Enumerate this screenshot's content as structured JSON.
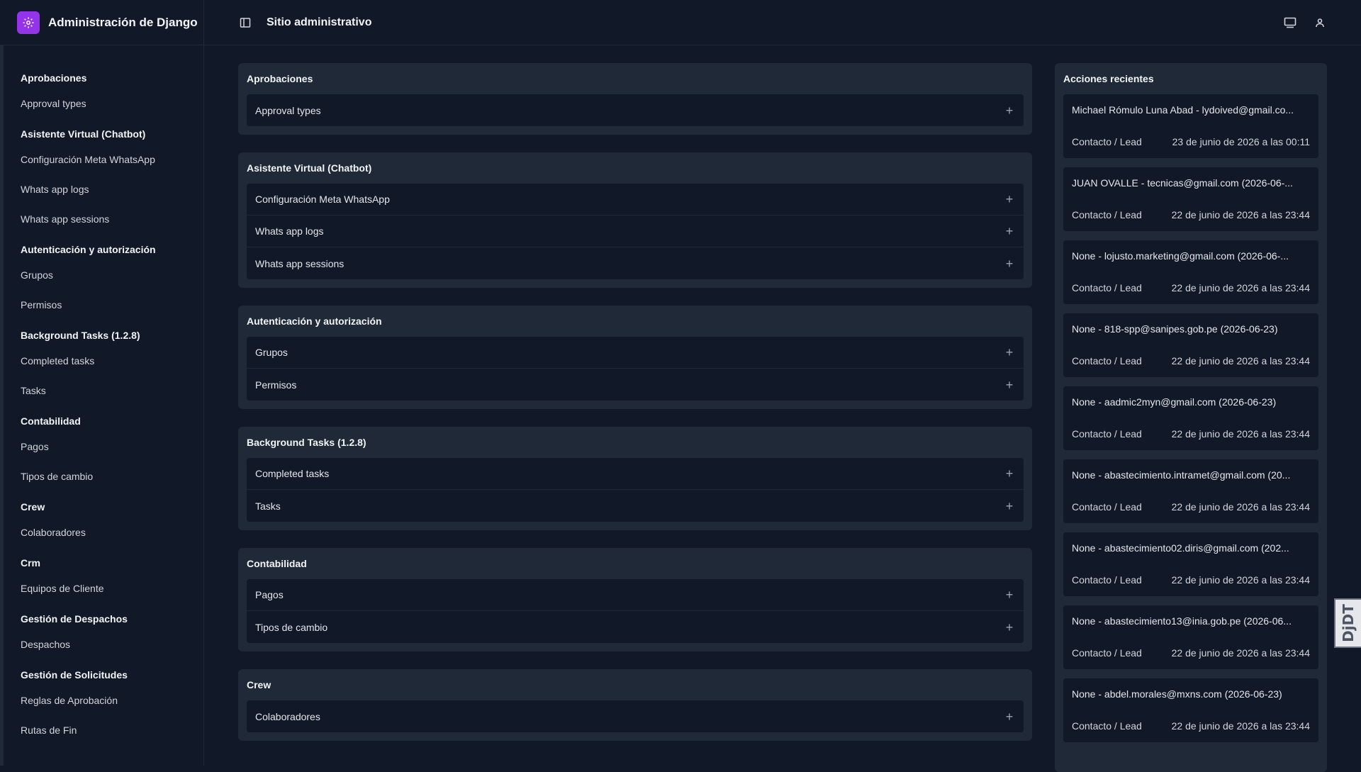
{
  "header": {
    "brand_title": "Administración de Django",
    "site_title": "Sitio administrativo"
  },
  "sidebar": {
    "groups": [
      {
        "title": "Aprobaciones",
        "items": [
          "Approval types"
        ]
      },
      {
        "title": "Asistente Virtual (Chatbot)",
        "items": [
          "Configuración Meta WhatsApp",
          "Whats app logs",
          "Whats app sessions"
        ]
      },
      {
        "title": "Autenticación y autorización",
        "items": [
          "Grupos",
          "Permisos"
        ]
      },
      {
        "title": "Background Tasks (1.2.8)",
        "items": [
          "Completed tasks",
          "Tasks"
        ]
      },
      {
        "title": "Contabilidad",
        "items": [
          "Pagos",
          "Tipos de cambio"
        ]
      },
      {
        "title": "Crew",
        "items": [
          "Colaboradores"
        ]
      },
      {
        "title": "Crm",
        "items": [
          "Equipos de Cliente"
        ]
      },
      {
        "title": "Gestión de Despachos",
        "items": [
          "Despachos"
        ]
      },
      {
        "title": "Gestión de Solicitudes",
        "items": [
          "Reglas de Aprobación",
          "Rutas de Fin"
        ]
      }
    ]
  },
  "main": {
    "modules": [
      {
        "title": "Aprobaciones",
        "rows": [
          "Approval types"
        ]
      },
      {
        "title": "Asistente Virtual (Chatbot)",
        "rows": [
          "Configuración Meta WhatsApp",
          "Whats app logs",
          "Whats app sessions"
        ]
      },
      {
        "title": "Autenticación y autorización",
        "rows": [
          "Grupos",
          "Permisos"
        ]
      },
      {
        "title": "Background Tasks (1.2.8)",
        "rows": [
          "Completed tasks",
          "Tasks"
        ]
      },
      {
        "title": "Contabilidad",
        "rows": [
          "Pagos",
          "Tipos de cambio"
        ]
      },
      {
        "title": "Crew",
        "rows": [
          "Colaboradores"
        ]
      }
    ]
  },
  "recent": {
    "title": "Acciones recientes",
    "actions": [
      {
        "object": "Michael Rómulo Luna Abad - lydoived@gmail.co...",
        "type": "Contacto / Lead",
        "date": "23 de junio de 2026 a las 00:11"
      },
      {
        "object": "JUAN OVALLE - tecnicas@gmail.com (2026-06-...",
        "type": "Contacto / Lead",
        "date": "22 de junio de 2026 a las 23:44"
      },
      {
        "object": "None - lojusto.marketing@gmail.com (2026-06-...",
        "type": "Contacto / Lead",
        "date": "22 de junio de 2026 a las 23:44"
      },
      {
        "object": "None - 818-spp@sanipes.gob.pe (2026-06-23)",
        "type": "Contacto / Lead",
        "date": "22 de junio de 2026 a las 23:44"
      },
      {
        "object": "None - aadmic2myn@gmail.com (2026-06-23)",
        "type": "Contacto / Lead",
        "date": "22 de junio de 2026 a las 23:44"
      },
      {
        "object": "None - abastecimiento.intramet@gmail.com (20...",
        "type": "Contacto / Lead",
        "date": "22 de junio de 2026 a las 23:44"
      },
      {
        "object": "None - abastecimiento02.diris@gmail.com (202...",
        "type": "Contacto / Lead",
        "date": "22 de junio de 2026 a las 23:44"
      },
      {
        "object": "None - abastecimiento13@inia.gob.pe (2026-06...",
        "type": "Contacto / Lead",
        "date": "22 de junio de 2026 a las 23:44"
      },
      {
        "object": "None - abdel.morales@mxns.com (2026-06-23)",
        "type": "Contacto / Lead",
        "date": "22 de junio de 2026 a las 23:44"
      }
    ]
  },
  "debug_toolbar": {
    "label": "DjDT"
  },
  "icons": {
    "brand": "gear-icon",
    "sidebar_toggle": "sidebar-toggle-icon",
    "theme": "monitor-icon",
    "user": "user-icon",
    "add": "plus-icon"
  },
  "colors": {
    "background": "#111827",
    "panel": "#1f2937",
    "brand": "#9333ea"
  }
}
